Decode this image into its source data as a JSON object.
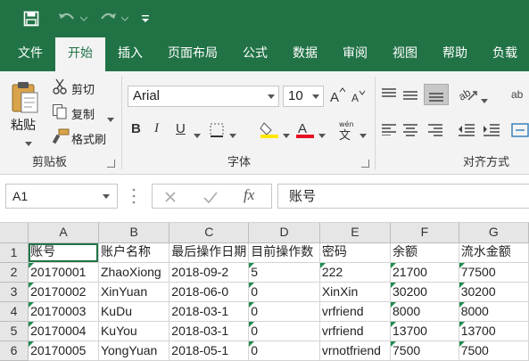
{
  "ribbon_tabs": [
    "文件",
    "开始",
    "插入",
    "页面布局",
    "公式",
    "数据",
    "审阅",
    "视图",
    "帮助",
    "负载"
  ],
  "active_tab": "开始",
  "clipboard": {
    "paste": "粘贴",
    "cut": "剪切",
    "copy": "复制",
    "format_painter": "格式刷",
    "group": "剪贴板"
  },
  "font": {
    "name": "Arial",
    "size": "10",
    "group": "字体"
  },
  "alignment": {
    "group": "对齐方式"
  },
  "name_box": "A1",
  "formula_value": "账号",
  "columns": [
    "A",
    "B",
    "C",
    "D",
    "E",
    "F",
    "G"
  ],
  "rows": [
    {
      "n": "1",
      "cells": [
        "账号",
        "账户名称",
        "最后操作日期",
        "目前操作数",
        "密码",
        "余额",
        "流水金额"
      ]
    },
    {
      "n": "2",
      "cells": [
        "20170001",
        "ZhaoXiong",
        "2018-09-2",
        "5",
        "222",
        "21700",
        "77500"
      ]
    },
    {
      "n": "3",
      "cells": [
        "20170002",
        "XinYuan",
        "2018-06-0",
        "0",
        "XinXin",
        "30200",
        "30200"
      ]
    },
    {
      "n": "4",
      "cells": [
        "20170003",
        "KuDu",
        "2018-03-1",
        "0",
        "vrfriend",
        "8000",
        "8000"
      ]
    },
    {
      "n": "5",
      "cells": [
        "20170004",
        "KuYou",
        "2018-03-1",
        "0",
        "vrfriend",
        "13700",
        "13700"
      ]
    },
    {
      "n": "6",
      "cells": [
        "20170005",
        "YongYuan",
        "2018-05-1",
        "0",
        "vrnotfriend",
        "7500",
        "7500"
      ]
    }
  ],
  "colors": {
    "accent": "#217346",
    "triangle": "#1e8c4e"
  },
  "icons": {
    "save": "save-icon",
    "undo": "undo-icon",
    "redo": "redo-icon",
    "customize": "customize-qat-icon"
  }
}
